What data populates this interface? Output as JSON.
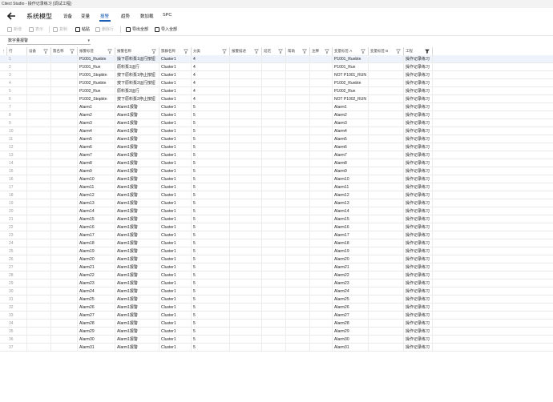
{
  "window": {
    "title": "Citect Studio - 操作记录练习 [调试工程]"
  },
  "nav": {
    "title": "系统模型",
    "tabs": [
      {
        "label": "设备",
        "active": false
      },
      {
        "label": "变量",
        "active": false
      },
      {
        "label": "报警",
        "active": true
      },
      {
        "label": "趋势",
        "active": false
      },
      {
        "label": "数加载",
        "active": false
      },
      {
        "label": "SPC",
        "active": false
      }
    ]
  },
  "toolbar": {
    "buttons": [
      {
        "label": "新增",
        "icon": "add-icon",
        "enabled": false
      },
      {
        "label": "表示",
        "icon": "view-icon",
        "enabled": false
      },
      {
        "label": "复制",
        "icon": "copy-icon",
        "enabled": false
      },
      {
        "label": "粘贴",
        "icon": "paste-icon",
        "enabled": true
      },
      {
        "label": "删除行",
        "icon": "delete-icon",
        "enabled": false
      },
      {
        "label": "导出全部",
        "icon": "export-icon",
        "enabled": true
      },
      {
        "label": "导入全部",
        "icon": "import-icon",
        "enabled": true
      }
    ]
  },
  "filter_select": {
    "value": "数字量报警"
  },
  "grid": {
    "columns": [
      {
        "label": "行"
      },
      {
        "label": "设备"
      },
      {
        "label": "簇名称"
      },
      {
        "label": "报警标签"
      },
      {
        "label": "报警名称"
      },
      {
        "label": "簇群名称"
      },
      {
        "label": "分类"
      },
      {
        "label": "报警描述"
      },
      {
        "label": "延迟"
      },
      {
        "label": "帮助"
      },
      {
        "label": "注释"
      },
      {
        "label": "变量标签 A"
      },
      {
        "label": "变量标签 B"
      },
      {
        "label": "工程"
      }
    ],
    "rows": [
      [
        "1",
        "",
        "",
        "P1001_Runbtn",
        "操下原料泵1运行按钮",
        "Cluster1",
        "4",
        "",
        "",
        "",
        "",
        "P1001_Runbtn",
        "",
        "操作记录练习"
      ],
      [
        "2",
        "",
        "",
        "P1001_Run",
        "原料泵1运行",
        "Cluster1",
        "4",
        "",
        "",
        "",
        "",
        "P1001_Run",
        "",
        "操作记录练习"
      ],
      [
        "3",
        "",
        "",
        "P1001_Stopbtn",
        "按下原料泵1停止按钮",
        "Cluster1",
        "4",
        "",
        "",
        "",
        "",
        "NOT P1001_RUN",
        "",
        "操作记录练习"
      ],
      [
        "4",
        "",
        "",
        "P1002_Runbtn",
        "按下原料泵2运行按钮",
        "Cluster1",
        "4",
        "",
        "",
        "",
        "",
        "P1002_Runbtn",
        "",
        "操作记录练习"
      ],
      [
        "5",
        "",
        "",
        "P1002_Run",
        "原料泵2运行",
        "Cluster1",
        "4",
        "",
        "",
        "",
        "",
        "P1002_Run",
        "",
        "操作记录练习"
      ],
      [
        "6",
        "",
        "",
        "P1002_Stopbtn",
        "按下原料泵2停止按钮",
        "Cluster1",
        "4",
        "",
        "",
        "",
        "",
        "NOT P1002_RUN",
        "",
        "操作记录练习"
      ],
      [
        "7",
        "",
        "",
        "Alarm1",
        "Alarm1报警",
        "Cluster1",
        "5",
        "",
        "",
        "",
        "",
        "Alarm1",
        "",
        "操作记录练习"
      ],
      [
        "8",
        "",
        "",
        "Alarm2",
        "Alarm1报警",
        "Cluster1",
        "5",
        "",
        "",
        "",
        "",
        "Alarm2",
        "",
        "操作记录练习"
      ],
      [
        "9",
        "",
        "",
        "Alarm3",
        "Alarm1报警",
        "Cluster1",
        "5",
        "",
        "",
        "",
        "",
        "Alarm3",
        "",
        "操作记录练习"
      ],
      [
        "10",
        "",
        "",
        "Alarm4",
        "Alarm1报警",
        "Cluster1",
        "5",
        "",
        "",
        "",
        "",
        "Alarm4",
        "",
        "操作记录练习"
      ],
      [
        "11",
        "",
        "",
        "Alarm5",
        "Alarm1报警",
        "Cluster1",
        "5",
        "",
        "",
        "",
        "",
        "Alarm5",
        "",
        "操作记录练习"
      ],
      [
        "12",
        "",
        "",
        "Alarm6",
        "Alarm1报警",
        "Cluster1",
        "5",
        "",
        "",
        "",
        "",
        "Alarm6",
        "",
        "操作记录练习"
      ],
      [
        "13",
        "",
        "",
        "Alarm7",
        "Alarm1报警",
        "Cluster1",
        "5",
        "",
        "",
        "",
        "",
        "Alarm7",
        "",
        "操作记录练习"
      ],
      [
        "14",
        "",
        "",
        "Alarm8",
        "Alarm1报警",
        "Cluster1",
        "5",
        "",
        "",
        "",
        "",
        "Alarm8",
        "",
        "操作记录练习"
      ],
      [
        "15",
        "",
        "",
        "Alarm9",
        "Alarm1报警",
        "Cluster1",
        "5",
        "",
        "",
        "",
        "",
        "Alarm9",
        "",
        "操作记录练习"
      ],
      [
        "16",
        "",
        "",
        "Alarm10",
        "Alarm1报警",
        "Cluster1",
        "5",
        "",
        "",
        "",
        "",
        "Alarm10",
        "",
        "操作记录练习"
      ],
      [
        "17",
        "",
        "",
        "Alarm11",
        "Alarm1报警",
        "Cluster1",
        "5",
        "",
        "",
        "",
        "",
        "Alarm11",
        "",
        "操作记录练习"
      ],
      [
        "18",
        "",
        "",
        "Alarm12",
        "Alarm1报警",
        "Cluster1",
        "5",
        "",
        "",
        "",
        "",
        "Alarm12",
        "",
        "操作记录练习"
      ],
      [
        "19",
        "",
        "",
        "Alarm13",
        "Alarm1报警",
        "Cluster1",
        "5",
        "",
        "",
        "",
        "",
        "Alarm13",
        "",
        "操作记录练习"
      ],
      [
        "20",
        "",
        "",
        "Alarm14",
        "Alarm1报警",
        "Cluster1",
        "5",
        "",
        "",
        "",
        "",
        "Alarm14",
        "",
        "操作记录练习"
      ],
      [
        "21",
        "",
        "",
        "Alarm15",
        "Alarm1报警",
        "Cluster1",
        "5",
        "",
        "",
        "",
        "",
        "Alarm15",
        "",
        "操作记录练习"
      ],
      [
        "22",
        "",
        "",
        "Alarm16",
        "Alarm1报警",
        "Cluster1",
        "5",
        "",
        "",
        "",
        "",
        "Alarm16",
        "",
        "操作记录练习"
      ],
      [
        "23",
        "",
        "",
        "Alarm17",
        "Alarm1报警",
        "Cluster1",
        "5",
        "",
        "",
        "",
        "",
        "Alarm17",
        "",
        "操作记录练习"
      ],
      [
        "24",
        "",
        "",
        "Alarm18",
        "Alarm1报警",
        "Cluster1",
        "5",
        "",
        "",
        "",
        "",
        "Alarm18",
        "",
        "操作记录练习"
      ],
      [
        "25",
        "",
        "",
        "Alarm19",
        "Alarm1报警",
        "Cluster1",
        "5",
        "",
        "",
        "",
        "",
        "Alarm19",
        "",
        "操作记录练习"
      ],
      [
        "26",
        "",
        "",
        "Alarm20",
        "Alarm1报警",
        "Cluster1",
        "5",
        "",
        "",
        "",
        "",
        "Alarm20",
        "",
        "操作记录练习"
      ],
      [
        "27",
        "",
        "",
        "Alarm21",
        "Alarm1报警",
        "Cluster1",
        "5",
        "",
        "",
        "",
        "",
        "Alarm21",
        "",
        "操作记录练习"
      ],
      [
        "28",
        "",
        "",
        "Alarm22",
        "Alarm1报警",
        "Cluster1",
        "5",
        "",
        "",
        "",
        "",
        "Alarm22",
        "",
        "操作记录练习"
      ],
      [
        "29",
        "",
        "",
        "Alarm23",
        "Alarm1报警",
        "Cluster1",
        "5",
        "",
        "",
        "",
        "",
        "Alarm23",
        "",
        "操作记录练习"
      ],
      [
        "30",
        "",
        "",
        "Alarm24",
        "Alarm1报警",
        "Cluster1",
        "5",
        "",
        "",
        "",
        "",
        "Alarm24",
        "",
        "操作记录练习"
      ],
      [
        "31",
        "",
        "",
        "Alarm25",
        "Alarm1报警",
        "Cluster1",
        "5",
        "",
        "",
        "",
        "",
        "Alarm25",
        "",
        "操作记录练习"
      ],
      [
        "32",
        "",
        "",
        "Alarm26",
        "Alarm1报警",
        "Cluster1",
        "5",
        "",
        "",
        "",
        "",
        "Alarm26",
        "",
        "操作记录练习"
      ],
      [
        "33",
        "",
        "",
        "Alarm27",
        "Alarm1报警",
        "Cluster1",
        "5",
        "",
        "",
        "",
        "",
        "Alarm27",
        "",
        "操作记录练习"
      ],
      [
        "34",
        "",
        "",
        "Alarm28",
        "Alarm1报警",
        "Cluster1",
        "5",
        "",
        "",
        "",
        "",
        "Alarm28",
        "",
        "操作记录练习"
      ],
      [
        "35",
        "",
        "",
        "Alarm29",
        "Alarm1报警",
        "Cluster1",
        "5",
        "",
        "",
        "",
        "",
        "Alarm29",
        "",
        "操作记录练习"
      ],
      [
        "36",
        "",
        "",
        "Alarm30",
        "Alarm1报警",
        "Cluster1",
        "5",
        "",
        "",
        "",
        "",
        "Alarm30",
        "",
        "操作记录练习"
      ],
      [
        "37",
        "",
        "",
        "Alarm31",
        "Alarm1报警",
        "Cluster1",
        "5",
        "",
        "",
        "",
        "",
        "Alarm31",
        "",
        "操作记录练习"
      ]
    ]
  },
  "colors": {
    "accent": "#1a5fb4",
    "grid_line": "#e9e9e9"
  }
}
